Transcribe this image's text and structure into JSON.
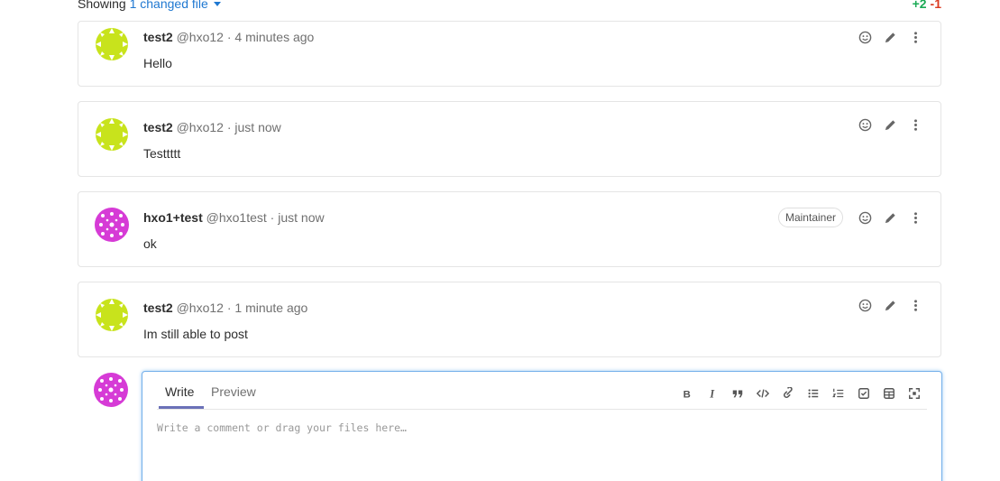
{
  "diff_header": {
    "showing_label": "Showing",
    "changed_files_link": "1 changed file",
    "additions": "+2",
    "deletions": "-1"
  },
  "notes": [
    {
      "author": "test2",
      "handle": "@hxo12",
      "separator": "·",
      "time": "4 minutes ago",
      "body": "Hello",
      "avatar_color": "#c8e31c",
      "badge": ""
    },
    {
      "author": "test2",
      "handle": "@hxo12",
      "separator": "·",
      "time": "just now",
      "body": "Testtttt",
      "avatar_color": "#c8e31c",
      "badge": ""
    },
    {
      "author": "hxo1+test",
      "handle": "@hxo1test",
      "separator": "·",
      "time": "just now",
      "body": "ok",
      "avatar_color": "#d63bd6",
      "badge": "Maintainer"
    },
    {
      "author": "test2",
      "handle": "@hxo12",
      "separator": "·",
      "time": "1 minute ago",
      "body": "Im still able to post",
      "avatar_color": "#c8e31c",
      "badge": ""
    }
  ],
  "note_actions": [
    "smiley-icon",
    "pencil-icon",
    "kebab-menu-icon"
  ],
  "editor": {
    "tab_write": "Write",
    "tab_preview": "Preview",
    "placeholder": "Write a comment or drag your files here…",
    "toolbar": [
      "bold-icon",
      "italic-icon",
      "quote-icon",
      "code-icon",
      "link-icon",
      "bullet-list-icon",
      "numbered-list-icon",
      "task-list-icon",
      "table-icon",
      "fullscreen-icon"
    ]
  },
  "colors": {
    "link": "#1f78d1",
    "additions": "#1aaa55",
    "deletions": "#db3b21",
    "editor_focus": "#73afea",
    "active_tab": "#6b71b8"
  }
}
